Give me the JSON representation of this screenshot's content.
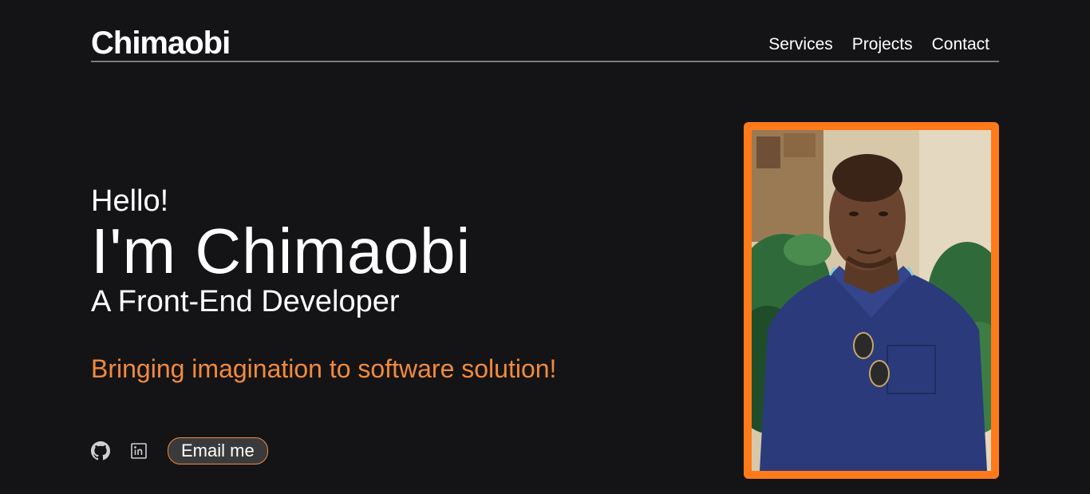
{
  "header": {
    "logo": "Chimaobi",
    "nav": [
      "Services",
      "Projects",
      "Contact"
    ]
  },
  "hero": {
    "greeting": "Hello!",
    "name": "I'm Chimaobi",
    "role": "A Front-End Developer",
    "tagline": "Bringing imagination to software solution!",
    "email_label": "Email me"
  },
  "socials": {
    "icons": [
      "github-icon",
      "linkedin-icon"
    ]
  },
  "colors": {
    "background": "#141416",
    "accent": "#f28a3d",
    "frame": "#ff7a1a",
    "shirt": "#2b3a7a"
  }
}
